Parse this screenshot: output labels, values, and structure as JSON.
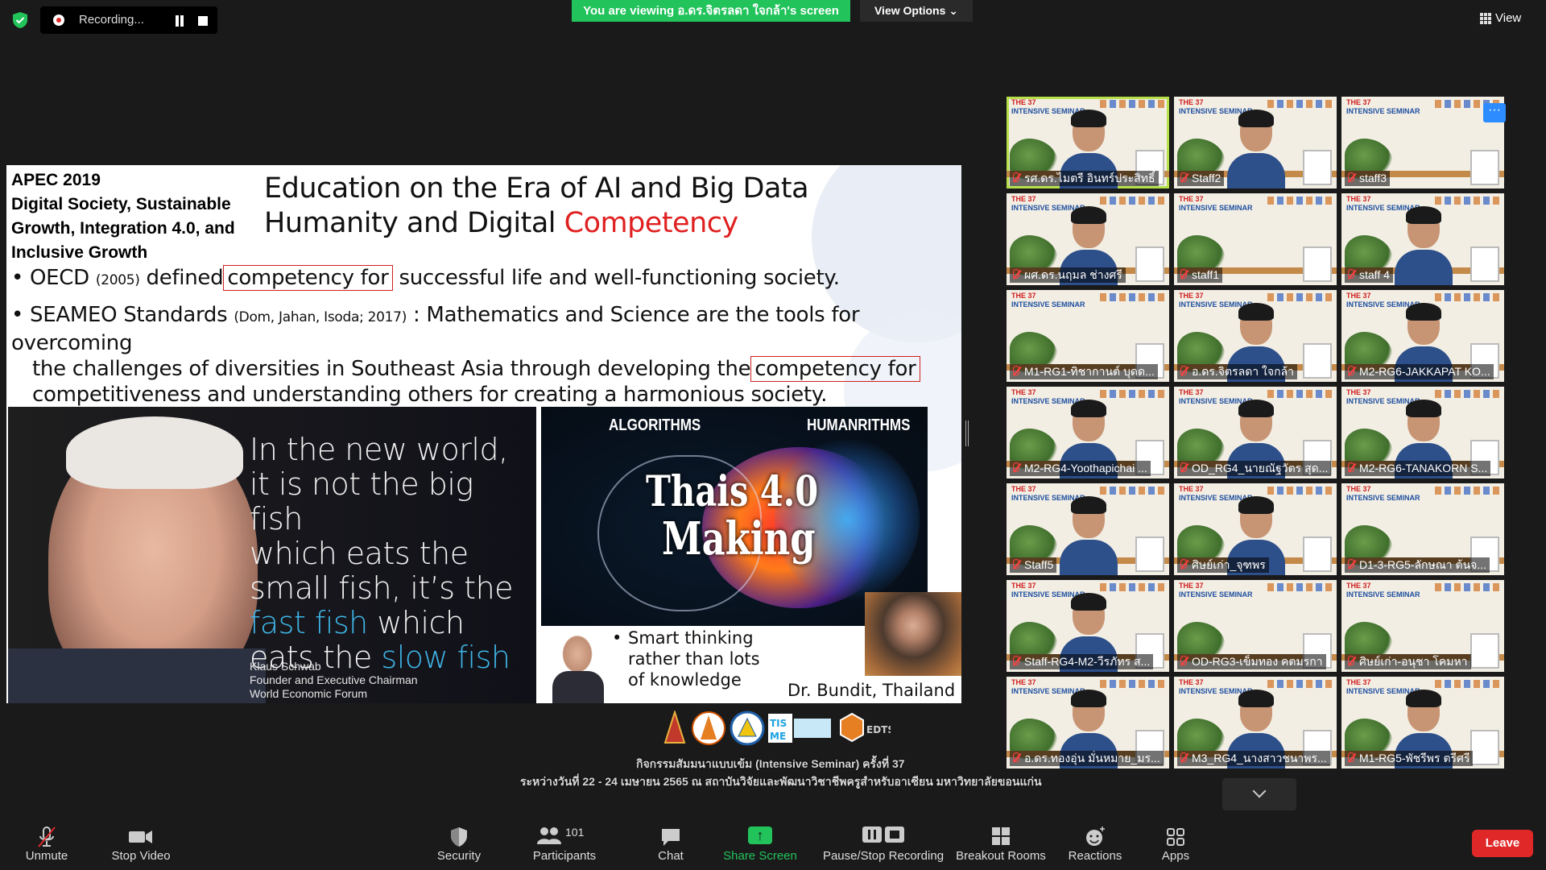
{
  "top_bar": {
    "recording_label": "Recording...",
    "viewing_banner": "You are viewing อ.ดร.จิตรลดา ใจกล้า's screen",
    "view_options": "View Options ⌄",
    "view_button": "View"
  },
  "slide": {
    "apec_lines": [
      "APEC 2019",
      "Digital Society, Sustainable",
      "Growth, Integration 4.0, and",
      "Inclusive Growth"
    ],
    "title_line1": "Education on the Era of AI and Big Data",
    "title_line2_pre": "Humanity and Digital ",
    "title_line2_red": "Competency",
    "bullet1": {
      "prefix": "OECD ",
      "small": "(2005)",
      "mid": " defined",
      "boxed": "competency for",
      "suffix": "successful life and well-functioning society."
    },
    "bullet2": {
      "prefix": "SEAMEO Standards ",
      "small": "(Dom, Jahan, Isoda; 2017)",
      "line1_rest": " : Mathematics and Science are the tools for overcoming",
      "line2_pre": "the challenges of diversities in Southeast Asia through developing the",
      "boxed": "competency for",
      "line3": "competitiveness and understanding others for creating a harmonious society."
    },
    "quote": {
      "l1": "In the new world,",
      "l2": "it is not the big fish",
      "l3": "which eats the",
      "l4": "small fish, it’s the",
      "l5_blue": "fast fish",
      "l5_rest": " which",
      "l6_pre": "eats the ",
      "l6_blue": "slow fish"
    },
    "credit": [
      "Klaus Schwab",
      "Founder and Executive Chairman",
      "World Economic Forum"
    ],
    "algorithms": "ALGORITHMS",
    "humanrithms": "HUMANRITHMS",
    "thais": "Thais 4.0",
    "making": "Making",
    "smart": [
      "Smart thinking",
      "rather than lots",
      "of knowledge"
    ],
    "bundit": "Dr. Bundit, Thailand"
  },
  "footer_caption": {
    "line1": "กิจกรรมสัมมนาแบบเข้ม (Intensive Seminar) ครั้งที่ 37",
    "line2": "ระหว่างวันที่ 22 - 24 เมษายน 2565 ณ สถาบันวิจัยและพัฒนาวิชาชีพครูสำหรับอาเซียน มหาวิทยาลัยขอนแก่น"
  },
  "gallery": {
    "tile_header_line1": "THE 37",
    "tile_header_line2": "INTENSIVE SEMINAR",
    "tiles": [
      {
        "name": "รศ.ดร.ไมตรี อินทร์ประสิทธิ์",
        "has_person": true
      },
      {
        "name": "Staff2",
        "has_person": true
      },
      {
        "name": "staff3",
        "has_person": false
      },
      {
        "name": "ผศ.ดร.นฤมล ช่างศรี",
        "has_person": true
      },
      {
        "name": "staff1",
        "has_person": false
      },
      {
        "name": "staff 4",
        "has_person": true
      },
      {
        "name": "M1-RG1-ทิชากานต์ บุดด...",
        "has_person": false
      },
      {
        "name": "อ.ดร.จิตรลดา ใจกล้า",
        "has_person": true
      },
      {
        "name": "M2-RG6-JAKKAPAT KO...",
        "has_person": true
      },
      {
        "name": "M2-RG4-Yoothapichai ...",
        "has_person": true
      },
      {
        "name": "OD_RG4_นายณัฐวัตร สุด...",
        "has_person": true
      },
      {
        "name": "M2-RG6-TANAKORN S...",
        "has_person": true
      },
      {
        "name": "Staff5",
        "has_person": true
      },
      {
        "name": "ศิษย์เก่า_จุฑพร",
        "has_person": true
      },
      {
        "name": "D1-3-RG5-ลักษณา ต้นจ...",
        "has_person": false
      },
      {
        "name": "Staff-RG4-M2-วีรภัทร ส...",
        "has_person": true
      },
      {
        "name": "OD-RG3-เข็มทอง คตมรกา",
        "has_person": false
      },
      {
        "name": "ศิษย์เก่า-อนุชา โคมหา",
        "has_person": false
      },
      {
        "name": "อ.ดร.ทองอุ่น มั่นหมาย_มร...",
        "has_person": true
      },
      {
        "name": "M3_RG4_นางสาวชนาพร...",
        "has_person": true
      },
      {
        "name": "M1-RG5-พัชรีพร ตรีศรี",
        "has_person": true
      }
    ],
    "more": "···"
  },
  "toolbar": {
    "unmute": "Unmute",
    "stop_video": "Stop Video",
    "security": "Security",
    "participants": "Participants",
    "participants_count": "101",
    "chat": "Chat",
    "share_screen": "Share Screen",
    "pause_stop_recording": "Pause/Stop Recording",
    "breakout_rooms": "Breakout Rooms",
    "reactions": "Reactions",
    "apps": "Apps",
    "leave": "Leave"
  },
  "colors": {
    "banner_green": "#23c35c",
    "active_tile_outline": "#b8e04a",
    "leave_red": "#e02828",
    "quote_blue": "#3fb5e6",
    "competency_red": "#e02020"
  }
}
